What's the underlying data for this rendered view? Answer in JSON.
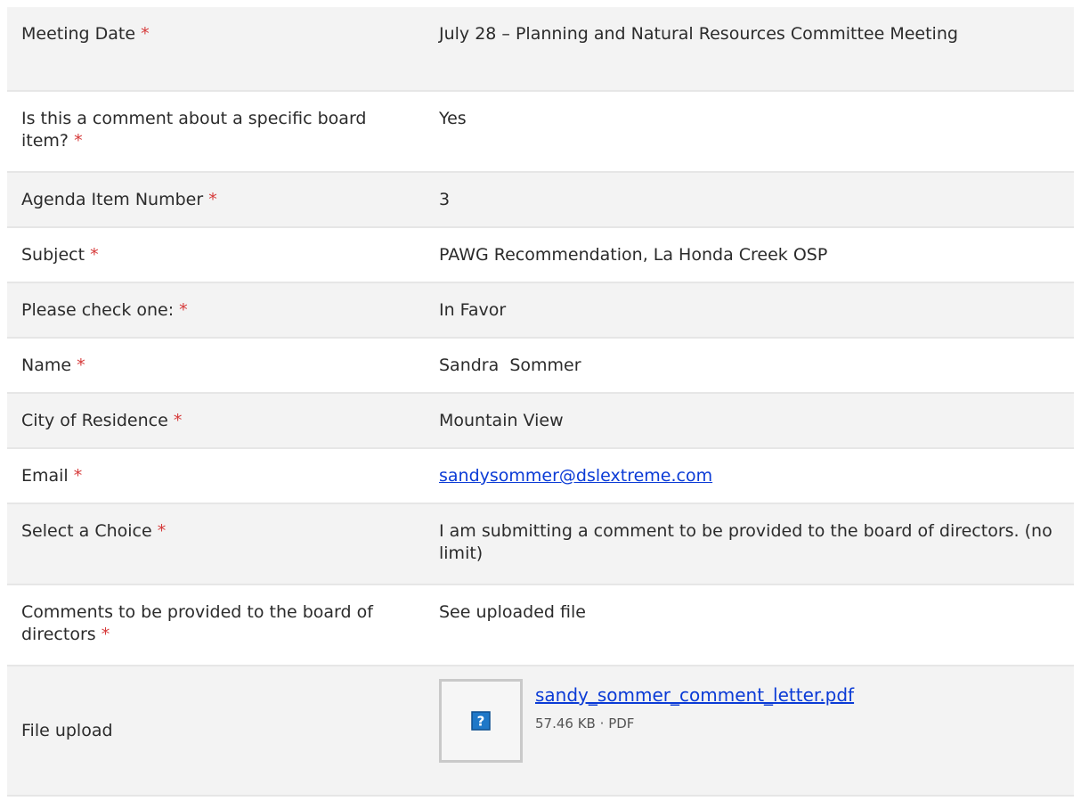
{
  "required_marker": "*",
  "rows": [
    {
      "label": "Meeting Date",
      "value": "July 28 – Planning and Natural Resources Committee Meeting"
    },
    {
      "label": "Is this a comment about a specific board item?",
      "value": "Yes"
    },
    {
      "label": "Agenda Item Number",
      "value": "3"
    },
    {
      "label": "Subject",
      "value": "PAWG Recommendation, La Honda Creek OSP"
    },
    {
      "label": "Please check one:",
      "value": "In Favor"
    },
    {
      "label": "Name",
      "value": "Sandra  Sommer"
    },
    {
      "label": "City of Residence",
      "value": "Mountain View"
    },
    {
      "label": "Email",
      "value": "sandysommer@dslextreme.com"
    },
    {
      "label": "Select a Choice",
      "value": "I am submitting a comment to be provided to the board of directors. (no limit)"
    },
    {
      "label": "Comments to be provided to the board of directors",
      "value": "See uploaded file"
    }
  ],
  "file_upload": {
    "label": "File upload",
    "file_name": "sandy_sommer_comment_letter.pdf",
    "file_size": "57.46 KB",
    "separator": "·",
    "file_type": "PDF",
    "icon": "question-icon"
  },
  "colors": {
    "row_alt": "#f3f3f3",
    "required": "#d63a3a",
    "link": "#0b3bd6"
  }
}
